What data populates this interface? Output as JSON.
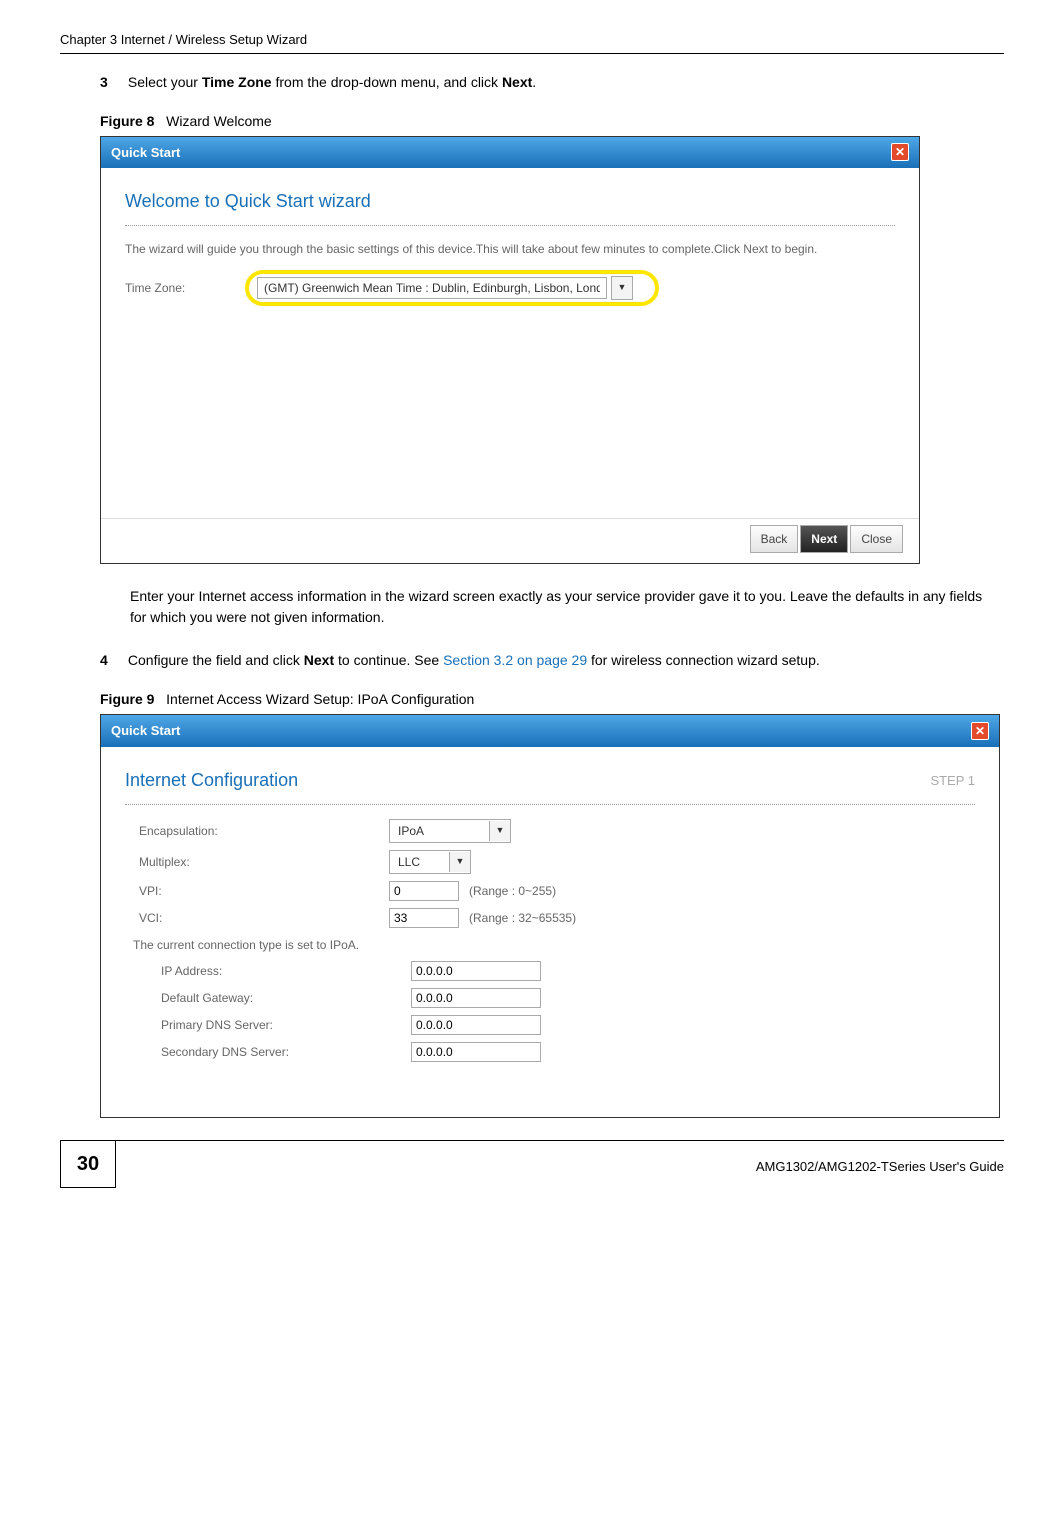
{
  "header": "Chapter 3 Internet / Wireless Setup Wizard",
  "steps": {
    "s3": {
      "num": "3",
      "text_before": "Select your ",
      "bold1": "Time Zone",
      "text_mid": " from the drop-down menu, and click ",
      "bold2": "Next",
      "text_after": "."
    },
    "s4": {
      "num": "4",
      "text_before": "Configure the field and click ",
      "bold1": "Next",
      "text_mid": " to continue. See ",
      "link": "Section 3.2 on page 29",
      "text_after": " for wireless connection wizard setup."
    }
  },
  "figures": {
    "fig8": {
      "label": "Figure 8",
      "caption": "Wizard Welcome"
    },
    "fig9": {
      "label": "Figure 9",
      "caption": "Internet Access Wizard Setup: IPoA Configuration"
    }
  },
  "wizard1": {
    "bar_title": "Quick Start",
    "title": "Welcome to Quick Start wizard",
    "desc": "The wizard will guide you through the basic settings of this device.This will take about few minutes to complete.Click Next to begin.",
    "tz_label": "Time Zone:",
    "tz_value": "(GMT) Greenwich Mean Time : Dublin, Edinburgh, Lisbon, London",
    "btn_back": "Back",
    "btn_next": "Next",
    "btn_close": "Close"
  },
  "para_after_fig8": "Enter your Internet access information in the wizard screen exactly as your service provider gave it to you. Leave the defaults in any fields for which you were not given information.",
  "wizard2": {
    "bar_title": "Quick Start",
    "title": "Internet Configuration",
    "step_label": "STEP 1",
    "encapsulation_label": "Encapsulation:",
    "encapsulation_value": "IPoA",
    "multiplex_label": "Multiplex:",
    "multiplex_value": "LLC",
    "vpi_label": "VPI:",
    "vpi_value": "0",
    "vpi_hint": "(Range : 0~255)",
    "vci_label": "VCI:",
    "vci_value": "33",
    "vci_hint": "(Range : 32~65535)",
    "current_conn": "The current connection type is set to IPoA.",
    "ip_label": "IP Address:",
    "ip_value": "0.0.0.0",
    "gw_label": "Default Gateway:",
    "gw_value": "0.0.0.0",
    "dns1_label": "Primary DNS Server:",
    "dns1_value": "0.0.0.0",
    "dns2_label": "Secondary DNS Server:",
    "dns2_value": "0.0.0.0"
  },
  "footer": {
    "page_num": "30",
    "guide": "AMG1302/AMG1202-TSeries User's Guide"
  }
}
